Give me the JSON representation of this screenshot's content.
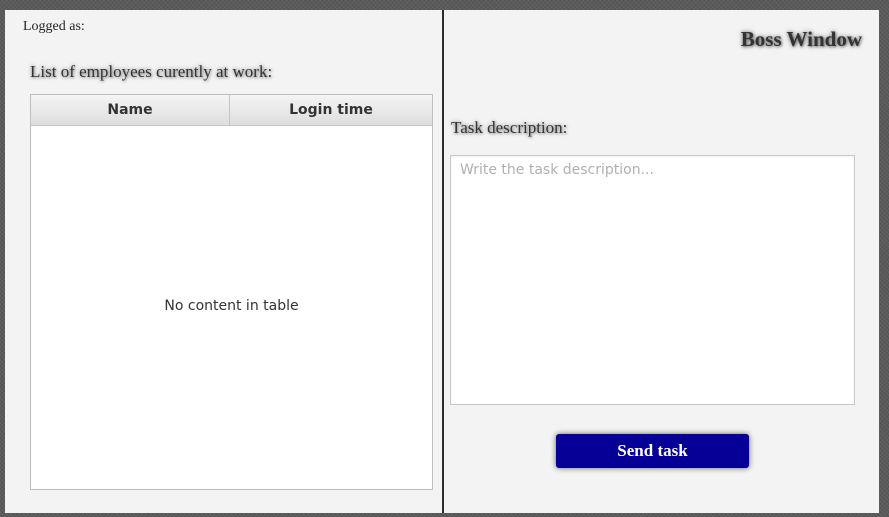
{
  "header": {
    "logged_as_label": "Logged as:",
    "window_title": "Boss Window"
  },
  "employees": {
    "section_label": "List of employees curently at work:",
    "columns": [
      "Name",
      "Login time"
    ],
    "rows": [],
    "empty_text": "No content in table"
  },
  "task": {
    "section_label": "Task description:",
    "placeholder": "Write the task description...",
    "value": "",
    "send_label": "Send task"
  },
  "colors": {
    "send_button": "#060096",
    "panel_background": "#f3f3f3",
    "divider": "#2b2b2b"
  }
}
